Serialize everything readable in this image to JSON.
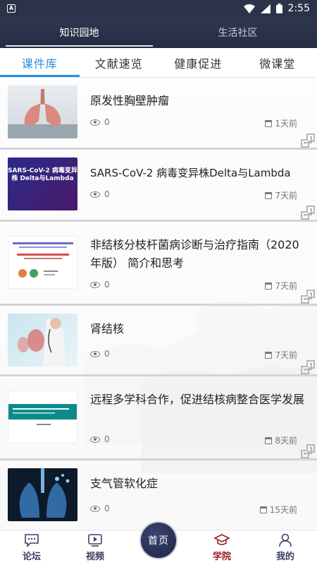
{
  "status_bar": {
    "time": "2:55"
  },
  "top_tabs": [
    {
      "label": "知识园地",
      "active": true
    },
    {
      "label": "生活社区",
      "active": false
    }
  ],
  "sub_tabs": [
    {
      "label": "课件库",
      "active": true
    },
    {
      "label": "文献速览",
      "active": false
    },
    {
      "label": "健康促进",
      "active": false
    },
    {
      "label": "微课堂",
      "active": false
    }
  ],
  "items": [
    {
      "title": "原发性胸壁肿瘤",
      "views": "0",
      "time": "1天前",
      "thumb_caption": ""
    },
    {
      "title": "SARS-CoV-2 病毒变异株Delta与Lambda",
      "views": "0",
      "time": "7天前",
      "thumb_caption": "SARS-CoV-2 病毒变异株 Delta与Lambda"
    },
    {
      "title": "非结核分枝杆菌病诊断与治疗指南（2020年版） 简介和思考",
      "views": "0",
      "time": "7天前",
      "thumb_caption": ""
    },
    {
      "title": "肾结核",
      "views": "0",
      "time": "7天前",
      "thumb_caption": ""
    },
    {
      "title": "远程多学科合作，促进结核病整合医学发展",
      "views": "0",
      "time": "8天前",
      "thumb_caption": ""
    },
    {
      "title": "支气管软化症",
      "views": "0",
      "time": "15天前",
      "thumb_caption": ""
    }
  ],
  "bottom_nav": [
    {
      "label": "论坛",
      "icon": "chat-icon",
      "active": false
    },
    {
      "label": "视频",
      "icon": "video-icon",
      "active": false
    },
    {
      "label": "首页",
      "icon": "home-icon",
      "active": false
    },
    {
      "label": "学院",
      "icon": "graduation-cap-icon",
      "active": true
    },
    {
      "label": "我的",
      "icon": "user-icon",
      "active": false
    }
  ],
  "colors": {
    "accent": "#2a8ce0",
    "header": "#2c3349",
    "nav_active": "#9b1b24"
  }
}
